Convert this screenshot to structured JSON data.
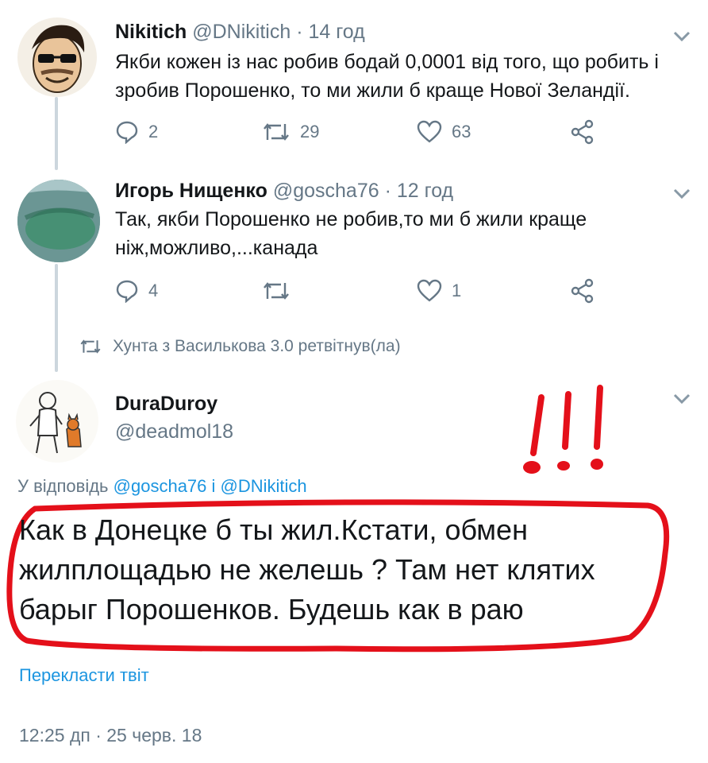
{
  "tweets": [
    {
      "name": "Nikitich",
      "handle": "@DNikitich",
      "time": "· 14 год",
      "text_line1": "Якби кожен із нас робив бодай 0,0001 від того, що робить і",
      "text_line2": "зробив Порошенко, то ми жили б краще Нової Зеландії.",
      "replies": "2",
      "retweets": "29",
      "likes": "63"
    },
    {
      "name": "Игорь Нищенко",
      "handle": "@goscha76",
      "time": "· 12 год",
      "text_line1": "Так, якби Порошенко не робив,то ми б жили краще",
      "text_line2": "ніж,можливо,...канада",
      "replies": "4",
      "retweets": "",
      "likes": "1"
    }
  ],
  "retweet_notice": "Хунта з Василькова 3.0 ретвітнув(ла)",
  "main_tweet": {
    "name": "DuraDuroy",
    "handle": "@deadmol18",
    "reply_prefix": "У відповідь",
    "reply_user1": "@goscha76",
    "reply_and": "і",
    "reply_user2": "@DNikitich",
    "text_line1": "Как в Донецке б ты жил.Кстати, обмен",
    "text_line2": "жилплощадью не желешь ? Там нет клятих",
    "text_line3": "барыг Порошенков. Будешь как в раю",
    "translate": "Перекласти твіт",
    "timestamp": "12:25 дп · 25 черв. 18"
  },
  "colors": {
    "accent": "#1b95e0",
    "secondary_text": "#657786",
    "annotation_red": "#e4101a"
  },
  "icons": [
    "reply-icon",
    "retweet-icon",
    "like-icon",
    "share-icon",
    "caret-down-icon"
  ]
}
